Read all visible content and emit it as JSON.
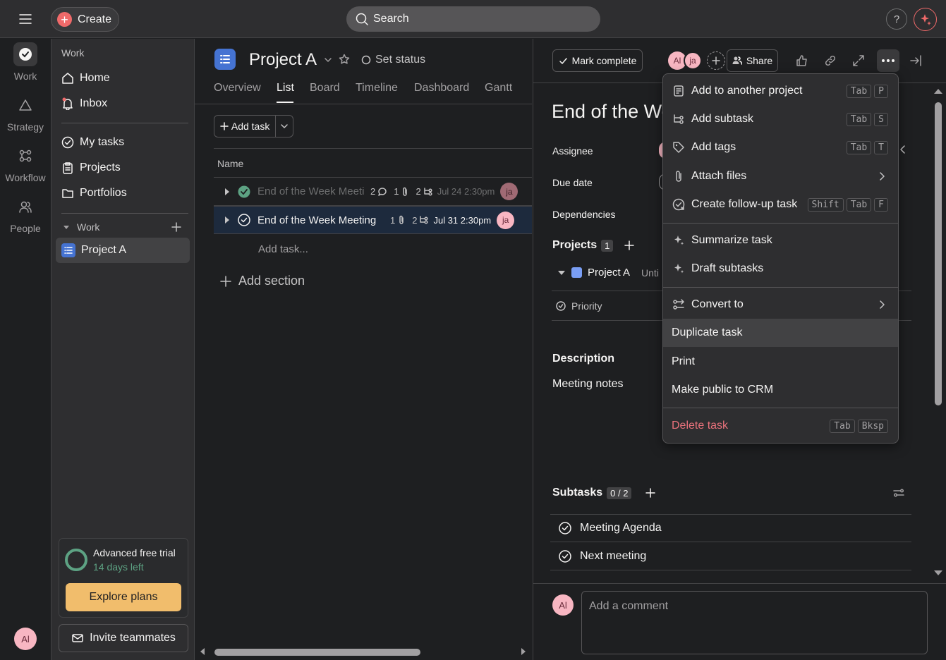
{
  "topbar": {
    "create_label": "Create",
    "search_placeholder": "Search",
    "help_label": "?"
  },
  "rail": {
    "items": [
      {
        "label": "Work"
      },
      {
        "label": "Strategy"
      },
      {
        "label": "Workflow"
      },
      {
        "label": "People"
      }
    ],
    "avatar_initials": "Al"
  },
  "sidebar": {
    "section_title": "Work",
    "nav": [
      {
        "label": "Home"
      },
      {
        "label": "Inbox"
      },
      {
        "label": "My tasks"
      },
      {
        "label": "Projects"
      },
      {
        "label": "Portfolios"
      }
    ],
    "work_group": {
      "label": "Work",
      "project": "Project A"
    },
    "trial": {
      "title": "Advanced free trial",
      "subtitle": "14 days left",
      "button": "Explore plans"
    },
    "invite_label": "Invite teammates"
  },
  "project": {
    "title": "Project A",
    "set_status": "Set status",
    "tabs": [
      "Overview",
      "List",
      "Board",
      "Timeline",
      "Dashboard",
      "Gantt"
    ],
    "active_tab": "List",
    "add_task_label": "Add task",
    "column_name": "Name",
    "tasks": [
      {
        "name": "End of the Week Meeting",
        "comments": "2",
        "attachments": "1",
        "subtasks": "2",
        "due": "Jul 24 2:30pm",
        "assignee": "ja",
        "completed": true
      },
      {
        "name": "End of the Week Meeting",
        "attachments": "1",
        "subtasks": "2",
        "due": "Jul 31 2:30pm",
        "assignee": "ja",
        "completed": false
      }
    ],
    "add_task_inline": "Add task...",
    "add_section": "Add section"
  },
  "detail": {
    "mark_complete": "Mark complete",
    "collaborators": [
      "Al",
      "ja"
    ],
    "share_label": "Share",
    "title": "End of the Week Meeting",
    "fields": {
      "assignee": "Assignee",
      "due_date": "Due date",
      "dependencies": "Dependencies"
    },
    "projects_label": "Projects",
    "projects_count": "1",
    "project_chip": "Project A",
    "project_section_partial": "Unti",
    "priority_label": "Priority",
    "description_label": "Description",
    "description_text": "Meeting notes",
    "subtasks_label": "Subtasks",
    "subtasks_count": "0 / 2",
    "subtasks": [
      "Meeting Agenda",
      "Next meeting"
    ],
    "comment_avatar": "Al",
    "comment_placeholder": "Add a comment"
  },
  "menu": {
    "items": [
      {
        "label": "Add to another project",
        "icon": "add-project-icon",
        "keys": [
          "Tab",
          "P"
        ]
      },
      {
        "label": "Add subtask",
        "icon": "subtask-icon",
        "keys": [
          "Tab",
          "S"
        ]
      },
      {
        "label": "Add tags",
        "icon": "tag-icon",
        "keys": [
          "Tab",
          "T"
        ]
      },
      {
        "label": "Attach files",
        "icon": "paperclip-icon",
        "keys": []
      },
      {
        "label": "Create follow-up task",
        "icon": "follow-up-icon",
        "keys": [
          "Shift",
          "Tab",
          "F"
        ]
      },
      {
        "label": "Summarize task",
        "icon": "sparkle-icon",
        "keys": []
      },
      {
        "label": "Draft subtasks",
        "icon": "sparkle-icon",
        "keys": []
      },
      {
        "label": "Convert to",
        "icon": "convert-icon",
        "keys": []
      },
      {
        "label": "Duplicate task",
        "keys": []
      },
      {
        "label": "Print",
        "keys": []
      },
      {
        "label": "Make public to CRM",
        "keys": []
      },
      {
        "label": "Delete task",
        "keys": [
          "Tab",
          "Bksp"
        ]
      }
    ]
  },
  "colors": {
    "background": "#1e1f21",
    "panel": "#2e2e30",
    "accent_red": "#f06a6a",
    "complete_green": "#5da283",
    "trial_button": "#f1bd6c",
    "danger": "#e8717b",
    "project_blue": "#4573d2"
  }
}
